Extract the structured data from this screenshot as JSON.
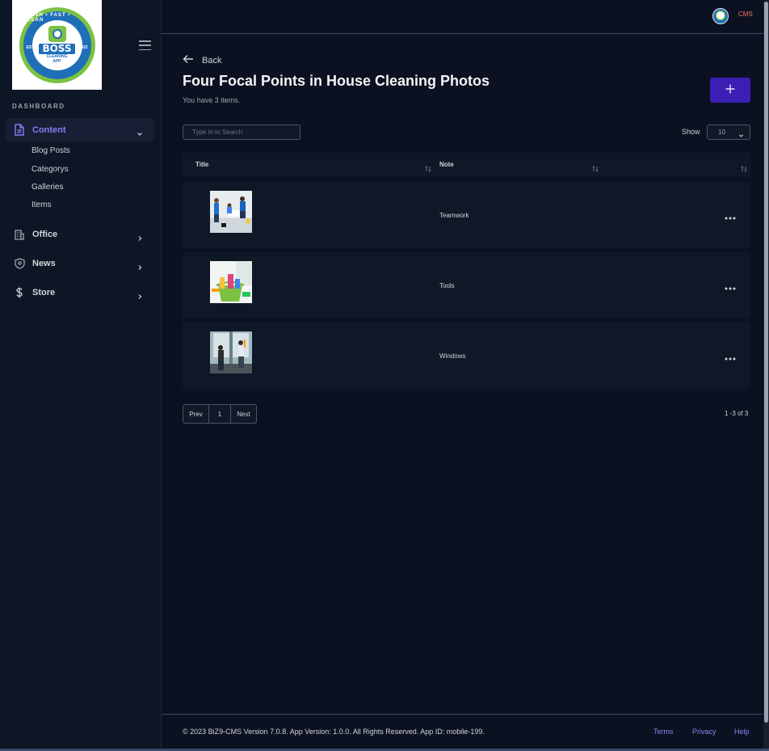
{
  "app": {
    "logo": {
      "top_text": "FRESH • FAST • CLEAN",
      "estd": "ESTD",
      "year": "2022",
      "name": "BOSS",
      "sub1": "CLEANING",
      "sub2": "APP"
    },
    "section_label": "DASHBOARD",
    "cms_link": "CMS"
  },
  "sidebar": {
    "content_label": "Content",
    "content_subitems": [
      "Blog Posts",
      "Categorys",
      "Galleries",
      "Items"
    ],
    "office_label": "Office",
    "news_label": "News",
    "store_label": "Store",
    "accent_color": "#8b7cf6"
  },
  "main": {
    "back_label": "Back",
    "title": "Four Focal Points in House Cleaning Photos",
    "subtitle": "You have 3 items.",
    "search_placeholder": "Type in to Search",
    "show_label": "Show",
    "show_value": "10",
    "columns": [
      "Title",
      "Note",
      ""
    ],
    "rows": [
      {
        "note": "Teamwork"
      },
      {
        "note": "Tools"
      },
      {
        "note": "Windows"
      }
    ],
    "pager": {
      "prev": "Prev",
      "page": "1",
      "next": "Next"
    },
    "count_text": "1 -3 of 3"
  },
  "footer": {
    "copyright": "© 2023 BiZ9-CMS Version 7.0.8. App Version: 1.0.0. All Rights Reserved. App ID: mobile-199.",
    "terms": "Terms",
    "privacy": "Privacy",
    "help": "Help"
  },
  "colors": {
    "background": "#0b1120",
    "primary_button": "#3b1fb5",
    "link": "#818cf8",
    "cms_link": "#f87171"
  }
}
